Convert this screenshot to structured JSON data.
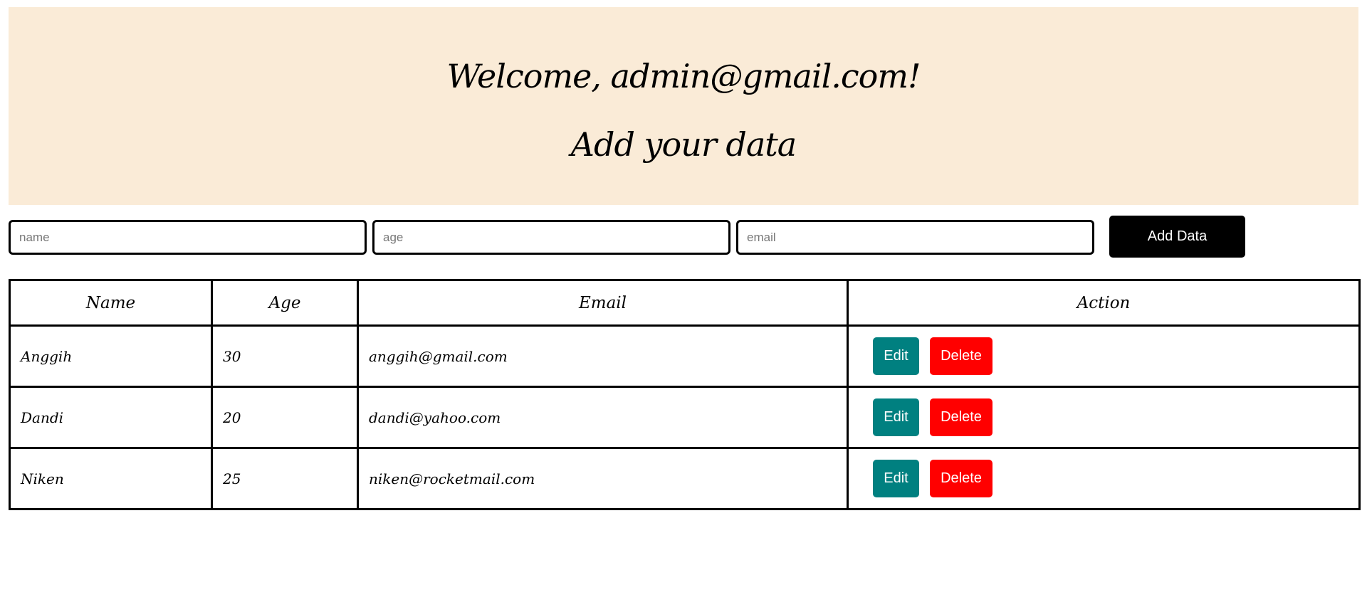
{
  "header": {
    "welcome": "Welcome, admin@gmail.com!",
    "subtitle": "Add your data",
    "background_color": "#faebd7"
  },
  "form": {
    "name_placeholder": "name",
    "name_value": "",
    "age_placeholder": "age",
    "age_value": "",
    "email_placeholder": "email",
    "email_value": "",
    "add_button_label": "Add Data",
    "add_button_color": "#000000"
  },
  "table": {
    "headers": [
      "Name",
      "Age",
      "Email",
      "Action"
    ],
    "rows": [
      {
        "name": "Anggih",
        "age": "30",
        "email": "anggih@gmail.com",
        "edit_label": "Edit",
        "delete_label": "Delete"
      },
      {
        "name": "Dandi",
        "age": "20",
        "email": "dandi@yahoo.com",
        "edit_label": "Edit",
        "delete_label": "Delete"
      },
      {
        "name": "Niken",
        "age": "25",
        "email": "niken@rocketmail.com",
        "edit_label": "Edit",
        "delete_label": "Delete"
      }
    ],
    "edit_button_color": "#008080",
    "delete_button_color": "#ff0000"
  }
}
